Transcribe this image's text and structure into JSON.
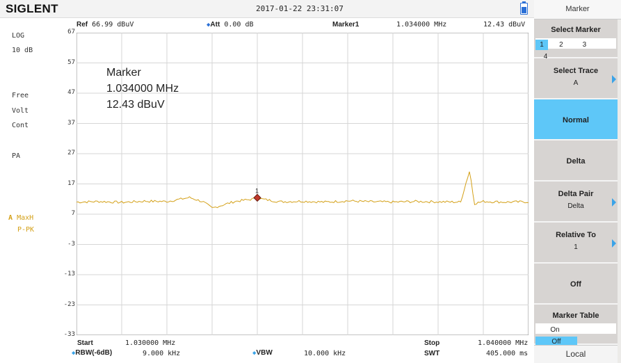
{
  "header": {
    "brand": "SIGLENT",
    "datetime": "2017-01-22  23:31:07",
    "ref_label": "Ref",
    "ref_value": "66.99 dBuV",
    "att_label": "Att",
    "att_value": "0.00 dB",
    "marker_label": "Marker1",
    "marker_freq": "1.034000 MHz",
    "marker_level": "12.43 dBuV"
  },
  "left_panel": {
    "scale_type": "LOG",
    "scale_div": "10 dB",
    "sweep_mode": "Free",
    "unit": "Volt",
    "run_mode": "Cont",
    "preamp": "PA",
    "trace_id": "A",
    "trace_mode": "MaxH",
    "detector": "P-PK"
  },
  "y_ticks": [
    "67",
    "57",
    "47",
    "37",
    "27",
    "17",
    "7",
    "-3",
    "-13",
    "-23",
    "-33"
  ],
  "marker_readout": {
    "title": "Marker",
    "freq": "1.034000 MHz",
    "level": "12.43 dBuV",
    "marker_number": "1"
  },
  "footer": {
    "start_label": "Start",
    "start_value": "1.030000 MHz",
    "stop_label": "Stop",
    "stop_value": "1.040000 MHz",
    "rbw_label": "RBW(-6dB)",
    "rbw_value": "9.000 kHz",
    "vbw_label": "VBW",
    "vbw_value": "10.000 kHz",
    "swt_label": "SWT",
    "swt_value": "405.000 ms"
  },
  "softkeys": {
    "menu_title": "Marker",
    "select_marker": {
      "label": "Select Marker",
      "options": [
        "1",
        "2",
        "3",
        "4"
      ],
      "selected": "1"
    },
    "select_trace": {
      "label": "Select Trace",
      "value": "A"
    },
    "normal": {
      "label": "Normal"
    },
    "delta": {
      "label": "Delta"
    },
    "delta_pair": {
      "label": "Delta Pair",
      "value": "Delta"
    },
    "relative_to": {
      "label": "Relative To",
      "value": "1"
    },
    "off": {
      "label": "Off"
    },
    "marker_table": {
      "label": "Marker Table",
      "on": "On",
      "off": "Off",
      "selected": "Off"
    },
    "local": "Local"
  },
  "colors": {
    "trace": "#d4a017",
    "accent": "#5ec7f8",
    "marker": "#c0392b"
  },
  "chart_data": {
    "type": "line",
    "x_unit": "MHz",
    "y_unit": "dBuV",
    "xlim": [
      1.03,
      1.04
    ],
    "ylim": [
      -33,
      67
    ],
    "marker": {
      "x": 1.034,
      "y": 12.43
    },
    "series": [
      {
        "x": [
          1.03,
          1.0305,
          1.031,
          1.0315,
          1.032,
          1.0325,
          1.0328,
          1.033,
          1.0335,
          1.034,
          1.0345,
          1.035,
          1.0355,
          1.036,
          1.0365,
          1.037,
          1.0375,
          1.038,
          1.0385,
          1.0386,
          1.0387,
          1.0388,
          1.039,
          1.0395,
          1.04
        ],
        "y": [
          11.0,
          11.2,
          10.9,
          11.3,
          11.2,
          12.5,
          11.1,
          9.0,
          11.2,
          12.2,
          11.1,
          11.3,
          11.0,
          11.4,
          11.1,
          11.0,
          11.2,
          11.1,
          11.0,
          16.5,
          21.5,
          10.5,
          11.2,
          11.0,
          11.1
        ]
      }
    ]
  }
}
